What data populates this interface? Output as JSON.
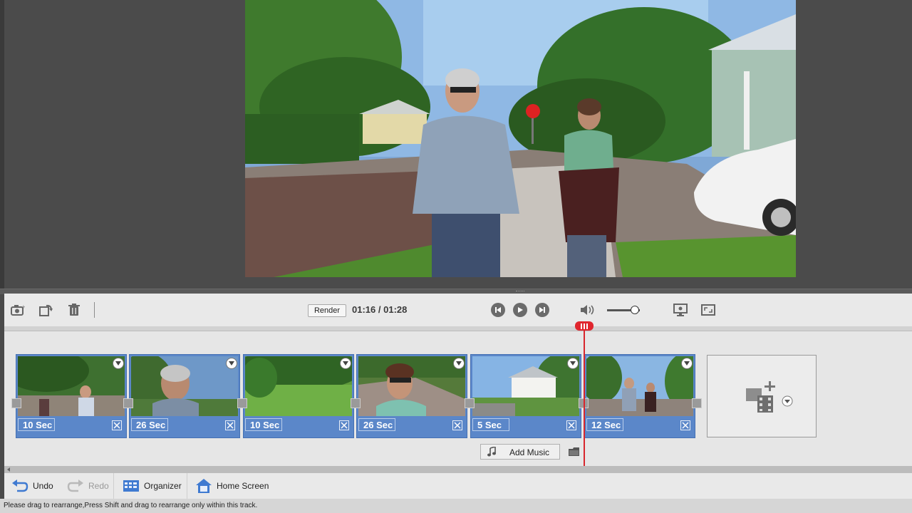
{
  "toolbar": {
    "render_label": "Render",
    "time_current": "01:16",
    "time_separator": "/",
    "time_total": "01:28",
    "volume_level": 0.85,
    "icons": [
      "camera-icon",
      "rotate-icon",
      "trash-icon",
      "previous-icon",
      "play-icon",
      "next-icon",
      "speaker-icon",
      "display-settings-icon",
      "fullscreen-icon"
    ]
  },
  "timeline": {
    "clips": [
      {
        "duration": "10 Sec"
      },
      {
        "duration": "26 Sec"
      },
      {
        "duration": "10 Sec"
      },
      {
        "duration": "26 Sec"
      },
      {
        "duration": "5 Sec"
      },
      {
        "duration": "12 Sec"
      }
    ],
    "add_music_label": "Add Music",
    "accent_color": "#5b87c9",
    "playhead_color": "#e0262e"
  },
  "actions": {
    "undo_label": "Undo",
    "redo_label": "Redo",
    "organizer_label": "Organizer",
    "home_label": "Home Screen"
  },
  "status": {
    "text": "Please drag to rearrange,Press Shift and drag to rearrange only within this track."
  }
}
